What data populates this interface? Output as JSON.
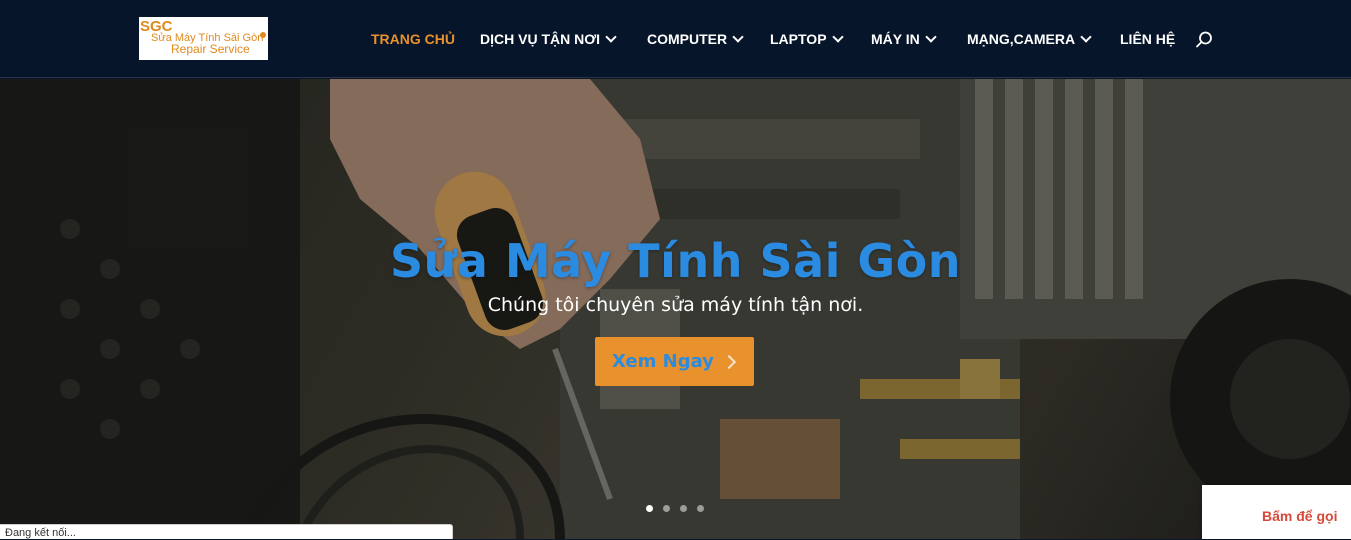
{
  "logo": {
    "mark": "SGC",
    "line1": "Sửa Máy Tính Sài Gòn",
    "line2": "Repair Service"
  },
  "nav": {
    "items": [
      {
        "label": "TRANG CHỦ",
        "active": true
      },
      {
        "label": "DỊCH VỤ TẬN NƠI",
        "dropdown": true
      },
      {
        "label": "COMPUTER",
        "dropdown": true
      },
      {
        "label": "LAPTOP",
        "dropdown": true
      },
      {
        "label": "MÁY IN",
        "dropdown": true
      },
      {
        "label": "MẠNG,CAMERA",
        "dropdown": true
      },
      {
        "label": "LIÊN HỆ"
      }
    ],
    "search_icon": "search-icon"
  },
  "hero": {
    "title": "Sửa Máy Tính Sài Gòn",
    "subtitle": "Chúng tôi chuyên sửa máy tính tận nơi.",
    "cta_label": "Xem Ngay",
    "slides": {
      "count": 4,
      "active_index": 0
    }
  },
  "status_bar": {
    "text": "Đang kết nối..."
  },
  "call_button": {
    "label": "Bấm để gọi"
  },
  "colors": {
    "header_bg": "#06152a",
    "accent_orange": "#e8912d",
    "title_blue": "#2a8be0",
    "call_red": "#d64a3a"
  }
}
